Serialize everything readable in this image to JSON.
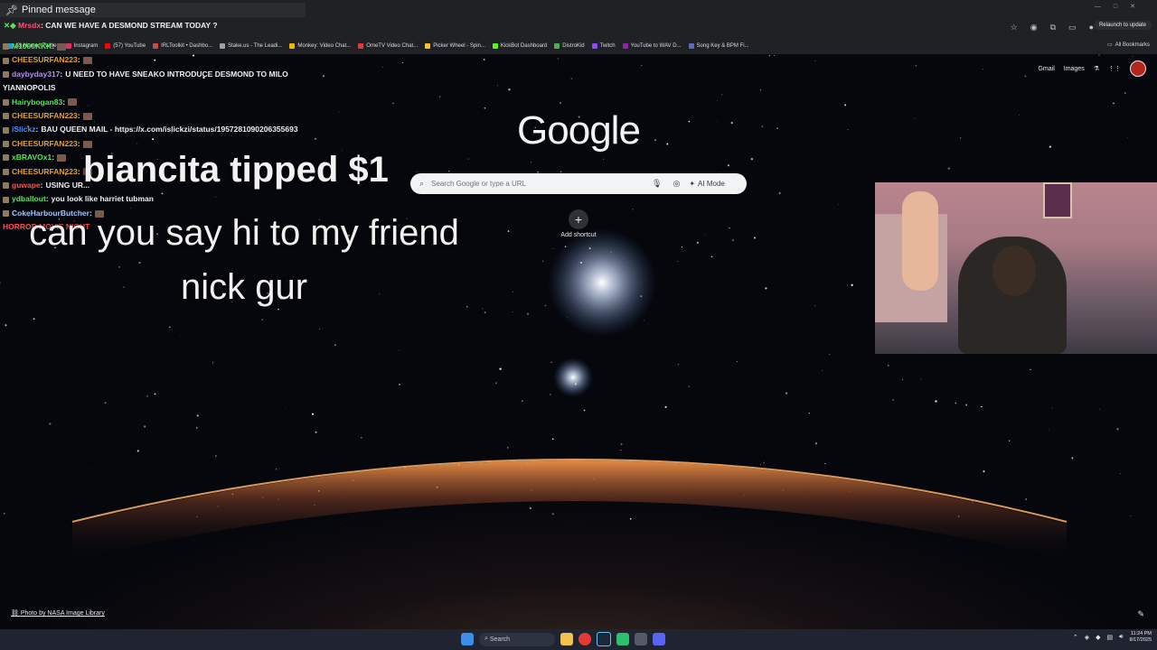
{
  "chrome": {
    "relaunch_label": "Relaunch to update",
    "bookmarks": [
      {
        "label": "(2) Home / Twitter",
        "color": "#1d9bf0"
      },
      {
        "label": "Instagram",
        "color": "#e1306c"
      },
      {
        "label": "(57) YouTube",
        "color": "#ff0000"
      },
      {
        "label": "IRLToolkit • Dashbo...",
        "color": "#c94a4a"
      },
      {
        "label": "Stake.us - The Leadi...",
        "color": "#9aa0a6"
      },
      {
        "label": "Monkey: Video Chat...",
        "color": "#f4b400"
      },
      {
        "label": "OmeTV Video Chat...",
        "color": "#e53935"
      },
      {
        "label": "Picker Wheel - Spin...",
        "color": "#fbc02d"
      },
      {
        "label": "KickBot Dashboard",
        "color": "#53fc18"
      },
      {
        "label": "DistroKid",
        "color": "#4caf50"
      },
      {
        "label": "Twitch",
        "color": "#9146ff"
      },
      {
        "label": "YouTube to WAV D...",
        "color": "#8e24aa"
      },
      {
        "label": "Song Key & BPM Fi...",
        "color": "#5c6bc0"
      }
    ],
    "all_bookmarks": "All Bookmarks"
  },
  "pinned": {
    "header": "Pinned message",
    "message": ": CAN WE HAVE A DESMOND STREAM TODAY ?"
  },
  "chat": [
    {
      "user": "M1000KKK",
      "color": "#56e35b",
      "text": ""
    },
    {
      "user": "CHEESURFAN223",
      "color": "#e0a03a",
      "text": ""
    },
    {
      "user": "daybyday317",
      "color": "#b98cf0",
      "text": "U NEED TO HAVE SNEAKO INTRODUCE DESMOND TO MILO"
    },
    {
      "user": "",
      "color": "#efeff1",
      "text": "YIANNOPOLIS"
    },
    {
      "user": "Hairybogan83",
      "color": "#56e35b",
      "text": ""
    },
    {
      "user": "CHEESURFAN223",
      "color": "#e0a03a",
      "text": ""
    },
    {
      "user": "iSlickz",
      "color": "#4f8ff0",
      "text": "BAU QUEEN MAIL - https://x.com/islickzi/status/1957281090206355693"
    },
    {
      "user": "CHEESURFAN223",
      "color": "#e0a03a",
      "text": ""
    },
    {
      "user": "xBRAVOx1",
      "color": "#56e35b",
      "text": ""
    },
    {
      "user": "CHEESURFAN223",
      "color": "#e0a03a",
      "text": ""
    },
    {
      "user": "guwape",
      "color": "#ff4f4f",
      "text": "USING UR..."
    },
    {
      "user": "ydballout",
      "color": "#56e35b",
      "text": "you look like harriet tubman"
    },
    {
      "user": "CokeHarbourButcher",
      "color": "#9fc5ff",
      "text": ""
    },
    {
      "user": "",
      "color": "#ff4f4f",
      "text": "HORROR MOVIE NIGHT"
    }
  ],
  "overlay": {
    "tip": "biancita tipped $1",
    "caption_line1": "can you say hi to my friend",
    "caption_line2": "nick gur"
  },
  "google": {
    "logo": "Google",
    "search_placeholder": "Search Google or type a URL",
    "ai_mode": "AI Mode",
    "add_shortcut": "Add shortcut",
    "gmail": "Gmail",
    "images": "Images",
    "photo_credit": "Photo by NASA Image Library"
  },
  "taskbar": {
    "search": "Search",
    "time": "11:24 PM",
    "date": "8/17/2025"
  }
}
